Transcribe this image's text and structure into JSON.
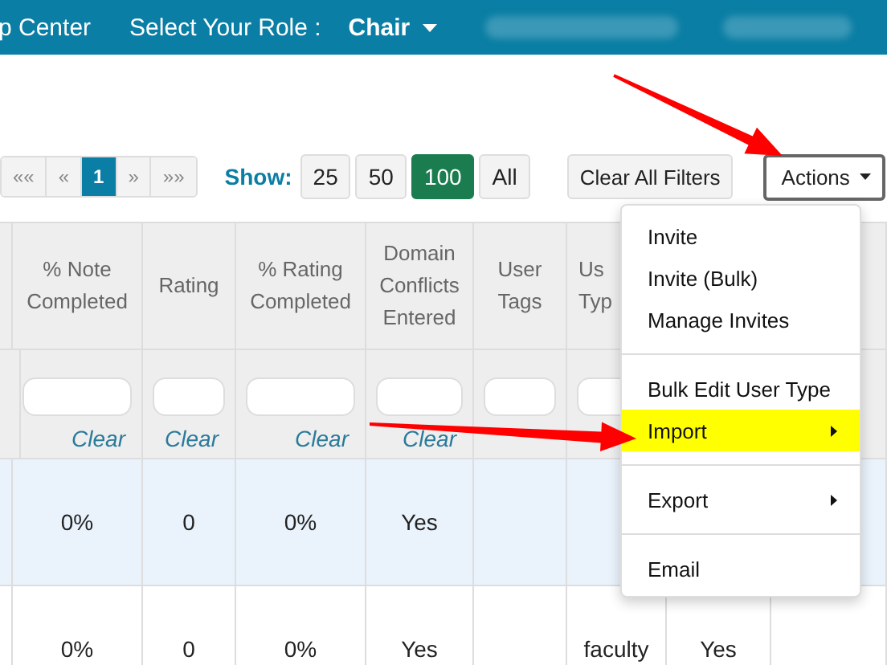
{
  "top_bar": {
    "app_name": "p Center",
    "role_label": "Select Your Role :",
    "role": "Chair"
  },
  "pagination": [
    {
      "label": "««",
      "selected": false
    },
    {
      "label": "«",
      "selected": false
    },
    {
      "label": "1",
      "selected": true
    },
    {
      "label": "»",
      "selected": false
    },
    {
      "label": "»»",
      "selected": false
    }
  ],
  "show": {
    "label": "Show:",
    "options": [
      {
        "label": "25",
        "selected": false
      },
      {
        "label": "50",
        "selected": false
      },
      {
        "label": "100",
        "selected": true
      },
      {
        "label": "All",
        "selected": false
      }
    ]
  },
  "clear_filters": "Clear All Filters",
  "actions": {
    "label": "Actions",
    "expanded": true,
    "menu": [
      {
        "kind": "item",
        "label": "Invite",
        "selected": false
      },
      {
        "kind": "item",
        "label": "Invite (Bulk)",
        "selected": false
      },
      {
        "kind": "item",
        "label": "Manage Invites",
        "selected": false
      },
      {
        "kind": "divider"
      },
      {
        "kind": "item",
        "label": "Bulk Edit User Type",
        "selected": false
      },
      {
        "kind": "submenu",
        "label": "Import",
        "selected": true
      },
      {
        "kind": "divider"
      },
      {
        "kind": "submenu",
        "label": "Export",
        "selected": false
      },
      {
        "kind": "divider"
      },
      {
        "kind": "item",
        "label": "Email",
        "selected": false
      }
    ]
  },
  "table": {
    "columns": [
      {},
      {
        "header": "% Note Completed",
        "clear": "Clear"
      },
      {
        "header": "Rating",
        "clear": "Clear"
      },
      {
        "header": "% Rating Completed",
        "clear": "Clear"
      },
      {
        "header": "Domain Conflicts Entered",
        "clear": "Clear"
      },
      {
        "header": "User Tags"
      },
      {
        "header": "Us Typ"
      },
      {},
      {}
    ],
    "rows": [
      {
        "selected": true,
        "cells": [
          null,
          "0%",
          "0",
          "0%",
          "Yes",
          null,
          null,
          null,
          null
        ]
      },
      {
        "selected": false,
        "cells": [
          null,
          "0%",
          "0",
          "0%",
          "Yes",
          null,
          "faculty",
          "Yes",
          null
        ]
      }
    ]
  }
}
